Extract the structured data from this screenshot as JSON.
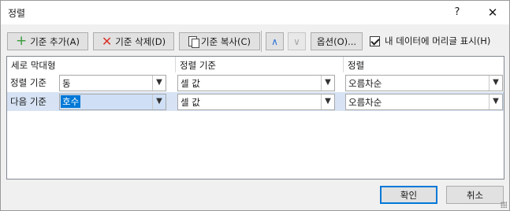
{
  "window": {
    "title": "정렬",
    "help_glyph": "?",
    "close_glyph": "✕"
  },
  "toolbar": {
    "add_level": "기준 추가(A)",
    "delete_level": "기준 삭제(D)",
    "copy_level": "기준 복사(C)",
    "move_up_glyph": "∧",
    "move_down_glyph": "∨",
    "options": "옵션(O)...",
    "header_checkbox_label": "내 데이터에 머리글 표시(H)",
    "header_checkbox_checked": true
  },
  "grid": {
    "headers": [
      "세로 막대형",
      "정렬 기준",
      "정렬"
    ],
    "rows": [
      {
        "label": "정렬 기준",
        "column": "동",
        "sort_on": "셀 값",
        "order": "오름차순",
        "selected": false
      },
      {
        "label": "다음 기준",
        "column": "호수",
        "sort_on": "셀 값",
        "order": "오름차순",
        "selected": true
      }
    ]
  },
  "footer": {
    "ok": "확인",
    "cancel": "취소"
  },
  "icons": {
    "add": "plus-icon",
    "delete": "x-icon",
    "copy": "copy-icon",
    "dropdown": "chevron-down-icon"
  },
  "colors": {
    "accent": "#0078d7",
    "selected_row": "#d7e3f4",
    "add_icon": "#3a9b3a",
    "delete_icon": "#d9342b"
  }
}
